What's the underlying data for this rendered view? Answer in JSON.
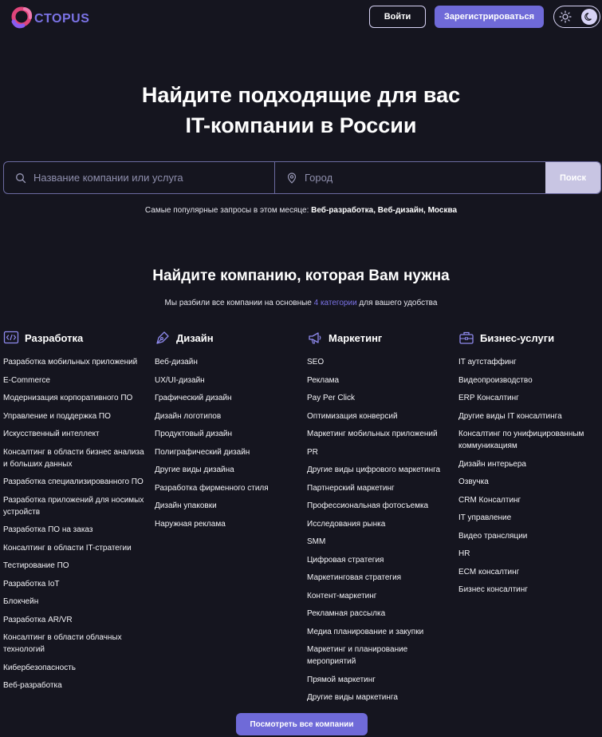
{
  "header": {
    "logo_text": "CTOPUS",
    "login_label": "Войти",
    "register_label": "Зарегистрироваться"
  },
  "hero": {
    "title_line1": "Найдите подходящие для вас",
    "title_line2": "IT-компании в России",
    "search_placeholder": "Название компании или услуга",
    "city_placeholder": "Город",
    "search_button": "Поиск",
    "popular_prefix": "Самые популярные запросы в этом месяце: ",
    "popular_links": "Веб-разработка, Веб-дизайн, Москва"
  },
  "section": {
    "title": "Найдите компанию, которая Вам нужна",
    "subtitle_before": "Мы разбили все компании на основные ",
    "subtitle_accent": "4 категории",
    "subtitle_after": " для вашего удобства"
  },
  "categories": [
    {
      "title": "Разработка",
      "icon": "code-icon",
      "items": [
        "Разработка мобильных приложений",
        "E-Commerce",
        "Модернизация корпоративного ПО",
        "Управление и поддержка ПО",
        "Искусственный интеллект",
        "Консалтинг в области бизнес анализа и больших данных",
        "Разработка специализированного ПО",
        "Разработка приложений для носимых устройств",
        "Разработка ПО на заказ",
        "Консалтинг в области IT-стратегии",
        "Тестирование ПО",
        "Разработка IoT",
        "Блокчейн",
        "Разработка AR/VR",
        "Консалтинг в области облачных технологий",
        "Кибербезопасность",
        "Веб-разработка"
      ]
    },
    {
      "title": "Дизайн",
      "icon": "pen-nib-icon",
      "items": [
        "Веб-дизайн",
        "UX/UI-дизайн",
        "Графический дизайн",
        "Дизайн логотипов",
        "Продуктовый дизайн",
        "Полиграфический дизайн",
        "Другие виды дизайна",
        "Разработка фирменного стиля",
        "Дизайн упаковки",
        "Наружная реклама"
      ]
    },
    {
      "title": "Маркетинг",
      "icon": "megaphone-icon",
      "items": [
        "SEO",
        "Реклама",
        "Pay Per Click",
        "Оптимизация конверсий",
        "Маркетинг мобильных приложений",
        "PR",
        "Другие виды цифрового маркетинга",
        "Партнерский маркетинг",
        "Профессиональная фотосъемка",
        "Исследования рынка",
        "SMM",
        "Цифровая стратегия",
        "Маркетинговая стратегия",
        "Контент-маркетинг",
        "Рекламная рассылка",
        "Медиа планирование и закупки",
        "Маркетинг и планирование мероприятий",
        "Прямой маркетинг",
        "Другие виды маркетинга"
      ]
    },
    {
      "title": "Бизнес-услуги",
      "icon": "briefcase-icon",
      "items": [
        "IT аутстаффинг",
        "Видеопроизводство",
        "ERP Консалтинг",
        "Другие виды IT консалтинга",
        "Консалтинг по унифицированным коммуникациям",
        "Дизайн интерьера",
        "Озвучка",
        "CRM Консалтинг",
        "IT управление",
        "Видео трансляции",
        "HR",
        "ECM консалтинг",
        "Бизнес консалтинг"
      ]
    }
  ],
  "view_all_label": "Посмотреть все компании",
  "colors": {
    "background": "#15151f",
    "accent": "#6f6ad8",
    "search_button": "#c8c5e3"
  }
}
